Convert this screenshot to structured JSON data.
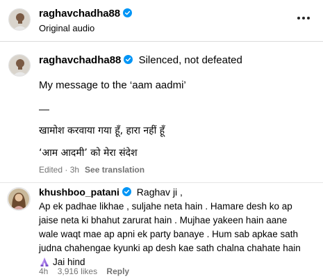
{
  "post_header": {
    "username": "raghavchadha88",
    "audio": "Original audio"
  },
  "caption": {
    "username": "raghavchadha88",
    "headline": "Silenced, not defeated",
    "line1": "My message to the ‘aam aadmi’",
    "dash": "—",
    "line2": "खामोश करवाया गया हूँ, हारा नहीं हूँ",
    "line3": "‘आम आदमी’ को मेरा संदेश",
    "edited": "Edited · 3h",
    "see_translation": "See translation"
  },
  "comment": {
    "username": "khushboo_patani",
    "mention": "Raghav ji ,",
    "body_lines": [
      "Ap ek padhae likhae , suljahe neta hain . Hamare desh ko ap",
      "jaise neta ki bhahut zarurat hain . Mujhae yakeen hain aane",
      "wale waqt mae ap apni ek party banaye . Hum sab apkae sath",
      "judna chahengae kyunki ap desh kae sath chalna chahate hain",
      "Jai hind"
    ],
    "time": "4h",
    "likes": "3,916 likes",
    "reply": "Reply"
  },
  "icons": {
    "verified": "verified-badge-icon",
    "more": "more-options-icon",
    "praying_hands": "praying-hands-emoji-icon"
  },
  "colors": {
    "verified_blue": "#0095f6",
    "secondary_text": "#737373"
  }
}
